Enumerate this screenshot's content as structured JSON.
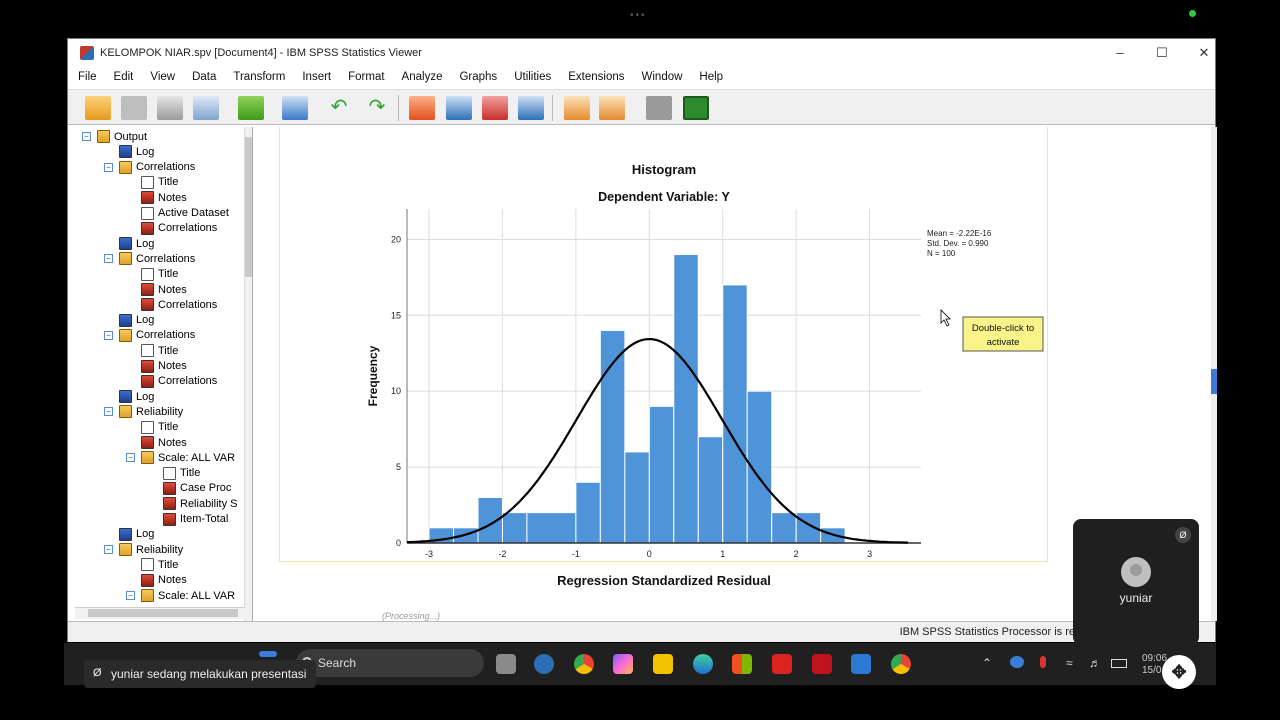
{
  "window": {
    "title": "KELOMPOK NIAR.spv [Document4] - IBM SPSS Statistics Viewer",
    "minimize": "–",
    "maximize": "☐",
    "close": "✕"
  },
  "menu": [
    "File",
    "Edit",
    "View",
    "Data",
    "Transform",
    "Insert",
    "Format",
    "Analyze",
    "Graphs",
    "Utilities",
    "Extensions",
    "Window",
    "Help"
  ],
  "outline": [
    {
      "label": "Output",
      "level": 0,
      "toggle": "−",
      "icon": "book"
    },
    {
      "label": "Log",
      "level": 1,
      "toggle": "",
      "icon": "log"
    },
    {
      "label": "Correlations",
      "level": 1,
      "toggle": "−",
      "icon": "book"
    },
    {
      "label": "Title",
      "level": 2,
      "toggle": "",
      "icon": "note"
    },
    {
      "label": "Notes",
      "level": 2,
      "toggle": "",
      "icon": "table"
    },
    {
      "label": "Active Dataset",
      "level": 2,
      "toggle": "",
      "icon": "note"
    },
    {
      "label": "Correlations",
      "level": 2,
      "toggle": "",
      "icon": "table"
    },
    {
      "label": "Log",
      "level": 1,
      "toggle": "",
      "icon": "log"
    },
    {
      "label": "Correlations",
      "level": 1,
      "toggle": "−",
      "icon": "book"
    },
    {
      "label": "Title",
      "level": 2,
      "toggle": "",
      "icon": "note"
    },
    {
      "label": "Notes",
      "level": 2,
      "toggle": "",
      "icon": "table"
    },
    {
      "label": "Correlations",
      "level": 2,
      "toggle": "",
      "icon": "table"
    },
    {
      "label": "Log",
      "level": 1,
      "toggle": "",
      "icon": "log"
    },
    {
      "label": "Correlations",
      "level": 1,
      "toggle": "−",
      "icon": "book"
    },
    {
      "label": "Title",
      "level": 2,
      "toggle": "",
      "icon": "note"
    },
    {
      "label": "Notes",
      "level": 2,
      "toggle": "",
      "icon": "table"
    },
    {
      "label": "Correlations",
      "level": 2,
      "toggle": "",
      "icon": "table"
    },
    {
      "label": "Log",
      "level": 1,
      "toggle": "",
      "icon": "log"
    },
    {
      "label": "Reliability",
      "level": 1,
      "toggle": "−",
      "icon": "book"
    },
    {
      "label": "Title",
      "level": 2,
      "toggle": "",
      "icon": "note"
    },
    {
      "label": "Notes",
      "level": 2,
      "toggle": "",
      "icon": "table"
    },
    {
      "label": "Scale: ALL VAR",
      "level": 2,
      "toggle": "−",
      "icon": "book"
    },
    {
      "label": "Title",
      "level": 3,
      "toggle": "",
      "icon": "note"
    },
    {
      "label": "Case Proc",
      "level": 3,
      "toggle": "",
      "icon": "table"
    },
    {
      "label": "Reliability S",
      "level": 3,
      "toggle": "",
      "icon": "table"
    },
    {
      "label": "Item-Total",
      "level": 3,
      "toggle": "",
      "icon": "table"
    },
    {
      "label": "Log",
      "level": 1,
      "toggle": "",
      "icon": "log"
    },
    {
      "label": "Reliability",
      "level": 1,
      "toggle": "−",
      "icon": "book"
    },
    {
      "label": "Title",
      "level": 2,
      "toggle": "",
      "icon": "note"
    },
    {
      "label": "Notes",
      "level": 2,
      "toggle": "",
      "icon": "table"
    },
    {
      "label": "Scale: ALL VAR",
      "level": 2,
      "toggle": "−",
      "icon": "book"
    }
  ],
  "chart_data": {
    "type": "bar",
    "title": "Histogram",
    "subtitle": "Dependent Variable: Y",
    "xlabel": "Regression Standardized Residual",
    "ylabel": "Frequency",
    "bin_edges": [
      -3.0,
      -2.667,
      -2.333,
      -2.0,
      -1.667,
      -1.0,
      -0.667,
      -0.333,
      0.0,
      0.333,
      0.667,
      1.0,
      1.333,
      1.667,
      2.0,
      2.333
    ],
    "values": [
      1,
      1,
      3,
      2,
      2,
      4,
      14,
      6,
      9,
      19,
      7,
      17,
      10,
      2,
      2,
      1
    ],
    "xlim": [
      -3.3,
      3.7
    ],
    "ylim": [
      0,
      22
    ],
    "xticks": [
      -3,
      -2,
      -1,
      0,
      1,
      2,
      3
    ],
    "yticks": [
      0,
      5,
      10,
      15,
      20
    ],
    "normal_curve": {
      "mean": 0,
      "sd": 0.99,
      "n": 100
    },
    "stats_text": [
      "Mean = -2.22E-16",
      "Std. Dev. = 0.990",
      "N = 100"
    ],
    "bar_color": "#4f93d9",
    "grid": true
  },
  "tooltip": "Double-click to activate",
  "processing": "(Processing...)",
  "status": "IBM SPSS Statistics Processor is re",
  "taskbar": {
    "search": "Search",
    "clock_time": "09:06",
    "clock_date": "15/0"
  },
  "presentation": "yuniar sedang melakukan presentasi",
  "participant": "yuniar"
}
